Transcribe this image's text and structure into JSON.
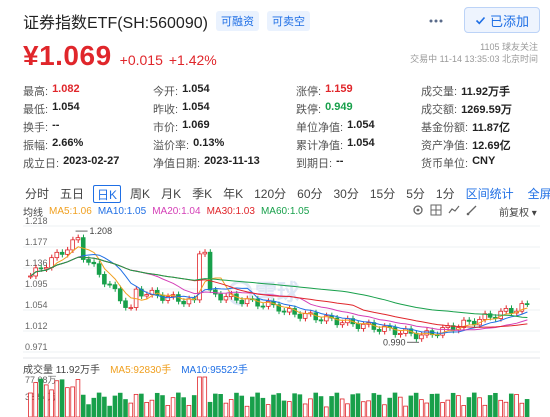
{
  "header": {
    "title": "证券指数ETF(SH:560090)",
    "tags": [
      "可融资",
      "可卖空"
    ],
    "follow_label": "已添加",
    "follow_icon": "check-icon",
    "more_icon": "more-icon"
  },
  "quote": {
    "price": "¥1.069",
    "change": "+0.015",
    "change_pct": "+1.42%",
    "followers": "1105 球友关注",
    "time": "交易中 11-14 13:35:03 北京时间"
  },
  "stats": [
    [
      {
        "k": "最高:",
        "v": "1.082",
        "color": "red"
      },
      {
        "k": "今开:",
        "v": "1.054",
        "color": ""
      },
      {
        "k": "涨停:",
        "v": "1.159",
        "color": "red"
      },
      {
        "k": "成交量:",
        "v": "11.92万手",
        "color": ""
      }
    ],
    [
      {
        "k": "最低:",
        "v": "1.054",
        "color": ""
      },
      {
        "k": "昨收:",
        "v": "1.054",
        "color": ""
      },
      {
        "k": "跌停:",
        "v": "0.949",
        "color": "green"
      },
      {
        "k": "成交额:",
        "v": "1269.59万",
        "color": ""
      }
    ],
    [
      {
        "k": "换手:",
        "v": "--",
        "color": ""
      },
      {
        "k": "市价:",
        "v": "1.069",
        "color": ""
      },
      {
        "k": "单位净值:",
        "v": "1.054",
        "color": ""
      },
      {
        "k": "基金份额:",
        "v": "11.87亿",
        "color": ""
      }
    ],
    [
      {
        "k": "振幅:",
        "v": "2.66%",
        "color": ""
      },
      {
        "k": "溢价率:",
        "v": "0.13%",
        "color": ""
      },
      {
        "k": "累计净值:",
        "v": "1.054",
        "color": ""
      },
      {
        "k": "资产净值:",
        "v": "12.69亿",
        "color": ""
      }
    ],
    [
      {
        "k": "成立日:",
        "v": "2023-02-27",
        "color": ""
      },
      {
        "k": "净值日期:",
        "v": "2023-11-13",
        "color": ""
      },
      {
        "k": "到期日:",
        "v": "--",
        "color": ""
      },
      {
        "k": "货币单位:",
        "v": "CNY",
        "color": ""
      }
    ]
  ],
  "tabs": [
    "分时",
    "五日",
    "日K",
    "周K",
    "月K",
    "季K",
    "年K",
    "120分",
    "60分",
    "30分",
    "15分",
    "5分",
    "1分"
  ],
  "active_tab": "日K",
  "tab_links": [
    "区间统计",
    "全屏显示"
  ],
  "ma": {
    "label": "均线",
    "items": [
      {
        "text": "MA5:1.06",
        "color": "#f0a020"
      },
      {
        "text": "MA10:1.05",
        "color": "#1f6fe5"
      },
      {
        "text": "MA20:1.04",
        "color": "#d43fb7"
      },
      {
        "text": "MA30:1.03",
        "color": "#e0262b"
      },
      {
        "text": "MA60:1.05",
        "color": "#18a04b"
      }
    ],
    "fq_label": "前复权"
  },
  "price_axis": [
    "1.218",
    "1.177",
    "1.136",
    "1.095",
    "1.054",
    "1.012",
    "0.971"
  ],
  "annotations": {
    "high": "1.208",
    "low": "0.990"
  },
  "watermark": "雪球",
  "volume": {
    "label": "成交量 11.92万手",
    "ma5": "MA5:92830手",
    "ma10": "MA10:95522手",
    "axis_top": "77.08万",
    "axis_mid": "38.54万"
  },
  "colors": {
    "up": "#e0262b",
    "down": "#18a04b",
    "accent": "#1f6fe5"
  }
}
